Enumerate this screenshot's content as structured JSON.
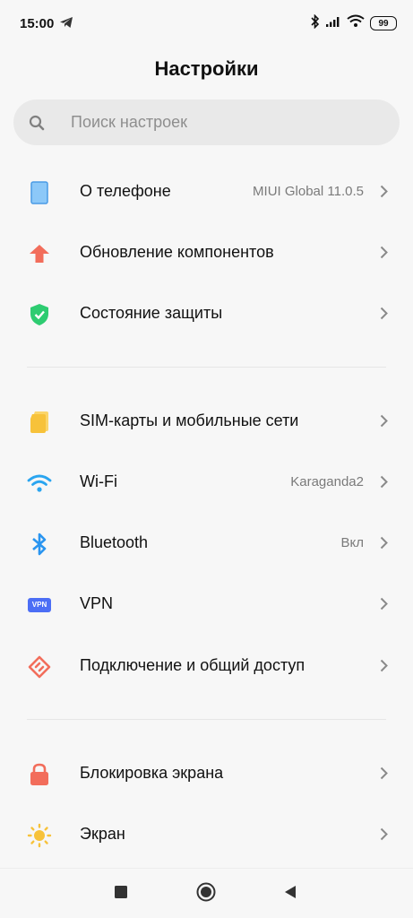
{
  "status": {
    "time": "15:00",
    "battery": "99"
  },
  "header": {
    "title": "Настройки"
  },
  "search": {
    "placeholder": "Поиск настроек"
  },
  "groups": [
    {
      "items": [
        {
          "label": "О телефоне",
          "value": "MIUI Global 11.0.5",
          "icon": "phone-icon"
        },
        {
          "label": "Обновление компонентов",
          "value": "",
          "icon": "arrow-up-icon"
        },
        {
          "label": "Состояние защиты",
          "value": "",
          "icon": "shield-check-icon"
        }
      ]
    },
    {
      "items": [
        {
          "label": "SIM-карты и мобильные сети",
          "value": "",
          "icon": "sim-card-icon"
        },
        {
          "label": "Wi-Fi",
          "value": "Karaganda2",
          "icon": "wifi-icon"
        },
        {
          "label": "Bluetooth",
          "value": "Вкл",
          "icon": "bluetooth-icon"
        },
        {
          "label": "VPN",
          "value": "",
          "icon": "vpn-icon",
          "badge": "VPN"
        },
        {
          "label": "Подключение и общий доступ",
          "value": "",
          "icon": "share-icon"
        }
      ]
    },
    {
      "items": [
        {
          "label": "Блокировка экрана",
          "value": "",
          "icon": "lock-icon"
        },
        {
          "label": "Экран",
          "value": "",
          "icon": "sun-icon"
        }
      ]
    }
  ],
  "colors": {
    "phone": "#5aaaf0",
    "update": "#f26d5b",
    "shield": "#2ecc71",
    "sim": "#f7c23a",
    "wifi": "#2aa5f0",
    "bluetooth": "#2a95f0",
    "vpn": "#4c6ef5",
    "share": "#f26d5b",
    "lock": "#f26d5b",
    "sun": "#f7c23a"
  }
}
